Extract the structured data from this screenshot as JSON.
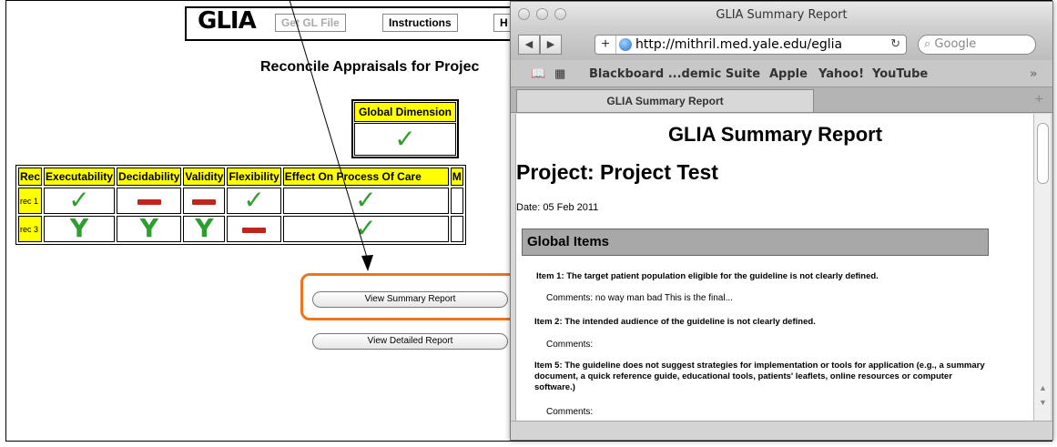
{
  "app": {
    "logo": "GLIA",
    "buttons": {
      "get_gl_file": "Get GL File",
      "instructions": "Instructions",
      "help_partial": "H"
    },
    "heading": "Reconcile Appraisals for Projec",
    "global_dimension": {
      "header": "Global Dimension",
      "mark": "check"
    },
    "table": {
      "headers": [
        "Rec",
        "Executability",
        "Decidability",
        "Validity",
        "Flexibility",
        "Effect On Process Of Care",
        "M"
      ],
      "rows": [
        {
          "label": "rec 1",
          "cells": [
            "check",
            "minus",
            "minus",
            "check",
            "check"
          ]
        },
        {
          "label": "rec 3",
          "cells": [
            "Y",
            "Y",
            "Y",
            "minus",
            "check"
          ]
        }
      ]
    },
    "view_summary": "View Summary Report",
    "view_detailed": "View Detailed Report"
  },
  "safari": {
    "window_title": "GLIA Summary Report",
    "url": "http://mithril.med.yale.edu/eglia",
    "search_placeholder": "Google",
    "bookmarks": [
      "Blackboard ...demic Suite",
      "Apple",
      "Yahoo!",
      "YouTube"
    ],
    "tab_title": "GLIA Summary Report",
    "report": {
      "title": "GLIA Summary Report",
      "project": "Project: Project Test",
      "date": "Date: 05 Feb 2011",
      "section": "Global Items",
      "items": [
        {
          "text": "Item 1: The target patient population eligible for the guideline is not clearly defined.",
          "comments": "Comments: no way man bad This is the final..."
        },
        {
          "text": "Item 2: The intended audience of the guideline is not clearly defined.",
          "comments": "Comments:"
        },
        {
          "text": "Item 5: The guideline does not suggest strategies for implementation or tools for application (e.g., a summary document, a quick reference guide, educational tools, patients' leaflets, online resources or computer software.)",
          "comments": "Comments:"
        }
      ]
    }
  },
  "colors": {
    "highlight": "#f0731e",
    "check": "#2e9e2e",
    "minus": "#c0241a",
    "header_yellow": "#ffff00"
  }
}
